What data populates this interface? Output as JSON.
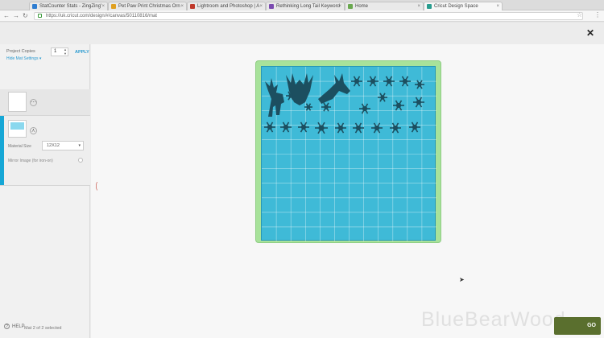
{
  "browser": {
    "tabs": [
      {
        "label": "StatCounter Stats - ZingZing'",
        "favicon_color": "#2e7dd1"
      },
      {
        "label": "Pet Paw Print Christmas Orn",
        "favicon_color": "#e0a020"
      },
      {
        "label": "Lightroom and Photoshop | A",
        "favicon_color": "#c0392b"
      },
      {
        "label": "Rethinking Long Tail Keyword",
        "favicon_color": "#7b4bb0"
      },
      {
        "label": "Home",
        "favicon_color": "#6aa84f"
      },
      {
        "label": "Cricut Design Space",
        "favicon_color": "#2a9d8f"
      }
    ],
    "url": "https://uk.cricut.com/design/#/canvas/50110816/mat"
  },
  "panel": {
    "project_copies_label": "Project Copies",
    "copies_value": "1",
    "apply_label": "APPLY",
    "hide_mat_settings": "Hide Mat Settings",
    "material_size_label": "Material Size",
    "material_size_value": "12X12",
    "mirror_label": "Mirror Image (for iron-on)",
    "mat_count": "Mat 2 of 2 selected"
  },
  "footer": {
    "help_label": "HELP",
    "watermark": "BlueBearWood",
    "go_label": "GO"
  },
  "colors": {
    "accent": "#16a7d6",
    "mat_green": "#a8e29a",
    "mat_blue": "#3fbad7"
  }
}
